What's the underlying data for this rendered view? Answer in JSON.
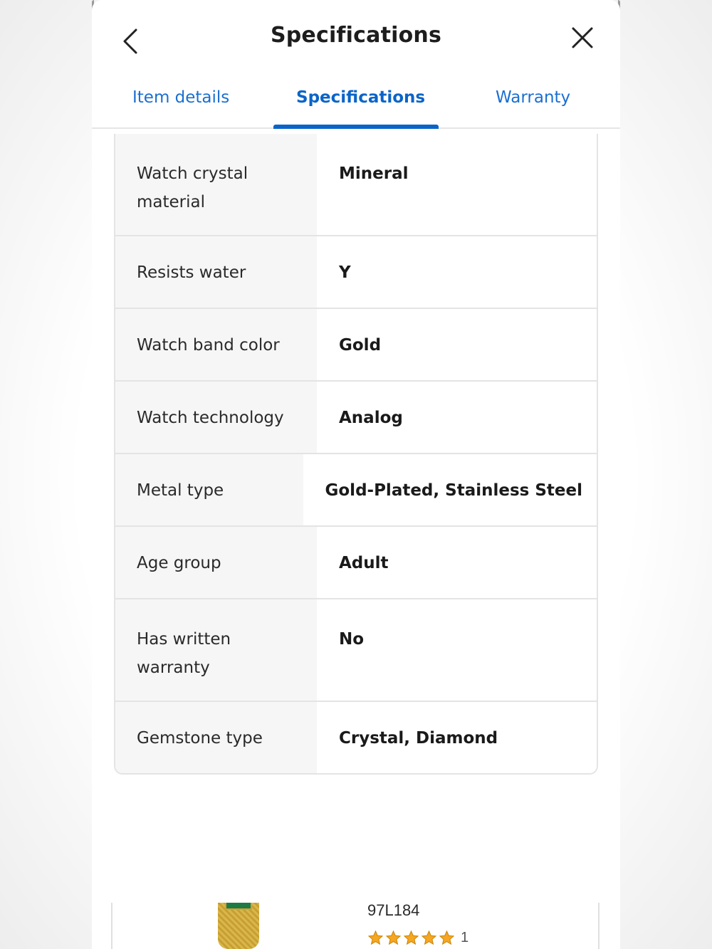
{
  "header": {
    "title": "Specifications"
  },
  "tabs": [
    {
      "label": "Item details",
      "active": false
    },
    {
      "label": "Specifications",
      "active": true
    },
    {
      "label": "Warranty",
      "active": false
    }
  ],
  "specs": [
    {
      "label": "Watch crystal material",
      "value": "Mineral"
    },
    {
      "label": "Resists water",
      "value": "Y"
    },
    {
      "label": "Watch band color",
      "value": "Gold"
    },
    {
      "label": "Watch technology",
      "value": "Analog"
    },
    {
      "label": "Metal type",
      "value": "Gold-Plated, Stainless Steel"
    },
    {
      "label": "Age group",
      "value": "Adult"
    },
    {
      "label": "Has written warranty",
      "value": "No"
    },
    {
      "label": "Gemstone type",
      "value": "Crystal, Diamond"
    }
  ],
  "product": {
    "sku": "97L184",
    "rating": 5,
    "rating_count": "1"
  },
  "colors": {
    "accent": "#0a64c8",
    "star": "#f5a623"
  },
  "icons": {
    "back": "chevron-left-icon",
    "close": "close-icon",
    "star": "star-icon"
  }
}
